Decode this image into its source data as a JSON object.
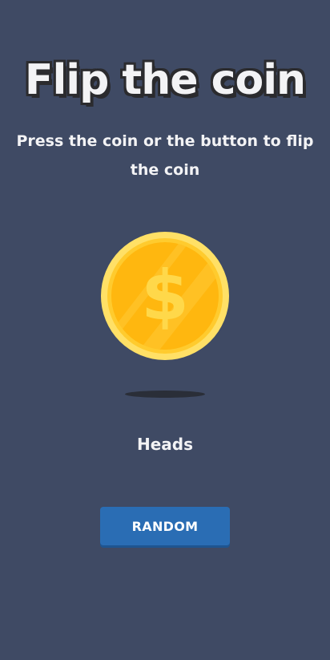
{
  "header": {
    "title": "Flip the coin",
    "subtitle": "Press the coin or the button to flip the coin"
  },
  "coin": {
    "icon": "dollar-coin-icon",
    "symbol": "$",
    "colors": {
      "rim": "#ffe066",
      "face": "#ffb70f",
      "symbol": "#ffd84a"
    }
  },
  "result": {
    "label": "Heads"
  },
  "actions": {
    "random_label": "RANDOM"
  },
  "colors": {
    "background": "#3f4a64",
    "button": "#2a6db4",
    "text": "#f3f3f5"
  }
}
